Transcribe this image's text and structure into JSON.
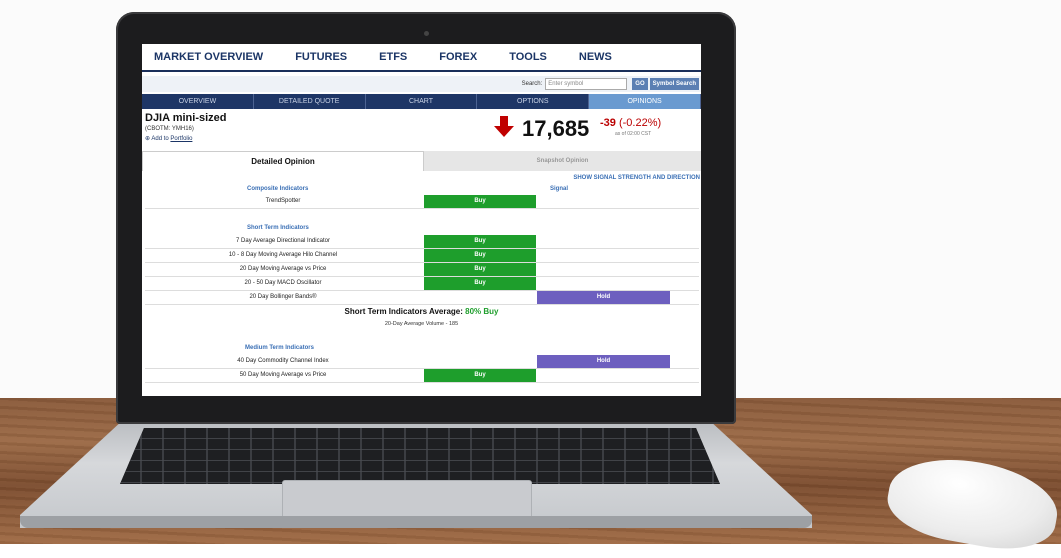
{
  "topnav": [
    "MARKET OVERVIEW",
    "FUTURES",
    "ETFS",
    "FOREX",
    "TOOLS",
    "NEWS"
  ],
  "search": {
    "label": "Search:",
    "placeholder": "Enter symbol",
    "go": "GO",
    "symbol_search": "Symbol Search"
  },
  "subtabs": [
    "OVERVIEW",
    "DETAILED QUOTE",
    "CHART",
    "OPTIONS",
    "OPINIONS"
  ],
  "quote": {
    "name": "DJIA mini-sized",
    "symbol": "(CBOTM: YMH16)",
    "add_to": "Add to",
    "portfolio": "Portfolio",
    "price": "17,685",
    "change": "-39",
    "change_pct": "(-0.22%)",
    "as_of": "as of 02:00 CST"
  },
  "opinion_tabs": {
    "detailed": "Detailed Opinion",
    "snapshot": "Snapshot Opinion"
  },
  "signal_link": "SHOW SIGNAL STRENGTH AND DIRECTION",
  "composite": {
    "header": "Composite Indicators",
    "signal_header": "Signal",
    "rows": [
      {
        "name": "TrendSpotter",
        "signal": "Buy"
      }
    ]
  },
  "short_term": {
    "header": "Short Term Indicators",
    "rows": [
      {
        "name": "7 Day Average Directional Indicator",
        "signal": "Buy"
      },
      {
        "name": "10 - 8 Day Moving Average Hilo Channel",
        "signal": "Buy"
      },
      {
        "name": "20 Day Moving Average vs Price",
        "signal": "Buy"
      },
      {
        "name": "20 - 50 Day MACD Oscillator",
        "signal": "Buy"
      },
      {
        "name": "20 Day Bollinger Bands®",
        "signal": "Hold"
      }
    ],
    "average_label": "Short Term Indicators Average:",
    "average_value": "80% Buy",
    "volume": "20-Day Average Volume - 185"
  },
  "medium_term": {
    "header": "Medium Term Indicators",
    "rows": [
      {
        "name": "40 Day Commodity Channel Index",
        "signal": "Hold"
      },
      {
        "name": "50 Day Moving Average vs Price",
        "signal": "Buy"
      }
    ]
  },
  "colors": {
    "buy": "#1e9e2c",
    "hold": "#6d5fbf",
    "nav": "#1e3666",
    "down": "#c00000"
  }
}
